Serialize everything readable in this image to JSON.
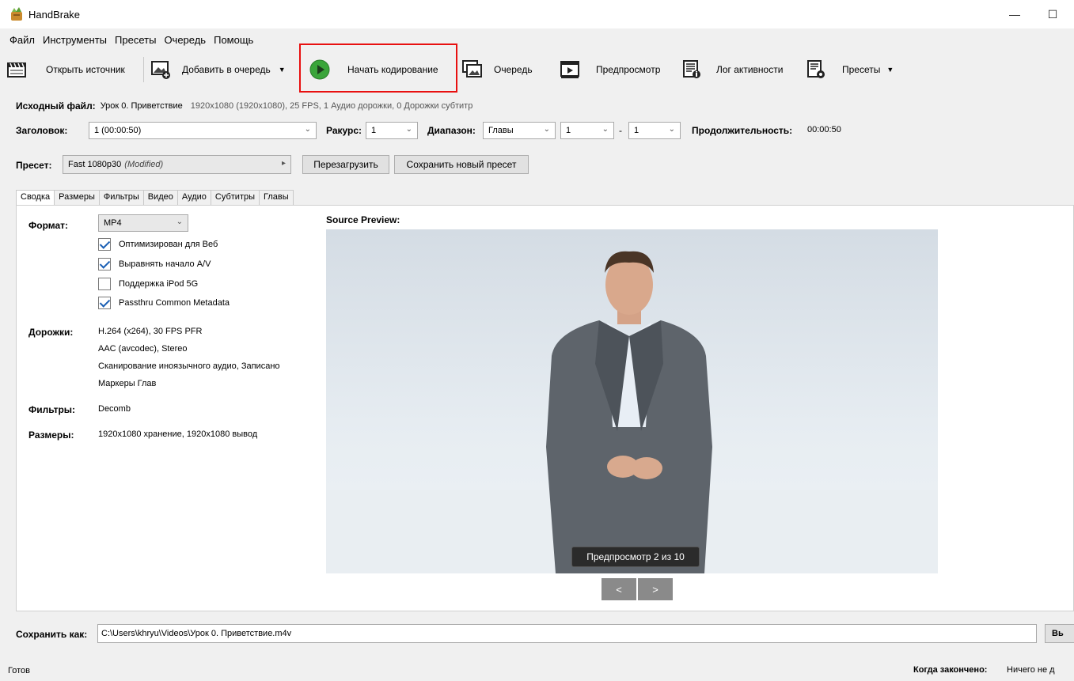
{
  "window": {
    "title": "HandBrake",
    "minimize": "—",
    "maximize": "☐"
  },
  "menu": [
    "Файл",
    "Инструменты",
    "Пресеты",
    "Очередь",
    "Помощь"
  ],
  "toolbar": {
    "open_source": "Открыть источник",
    "add_to_queue": "Добавить в очередь",
    "start_encode": "Начать кодирование",
    "queue": "Очередь",
    "preview": "Предпросмотр",
    "activity_log": "Лог активности",
    "presets": "Пресеты"
  },
  "source": {
    "label": "Исходный файл:",
    "name": "Урок 0. Приветствие",
    "info": "1920x1080 (1920x1080), 25 FPS, 1 Аудио дорожки, 0 Дорожки субтитр"
  },
  "title_row": {
    "title_label": "Заголовок:",
    "title_value": "1 (00:00:50)",
    "angle_label": "Ракурс:",
    "angle_value": "1",
    "range_label": "Диапазон:",
    "range_type": "Главы",
    "range_start": "1",
    "range_dash": "-",
    "range_end": "1",
    "duration_label": "Продолжительность:",
    "duration_value": "00:00:50"
  },
  "preset_row": {
    "label": "Пресет:",
    "value": "Fast 1080p30",
    "modified": "(Modified)",
    "reload": "Перезагрузить",
    "save_new": "Сохранить новый пресет"
  },
  "tabs": [
    "Сводка",
    "Размеры",
    "Фильтры",
    "Видео",
    "Аудио",
    "Субтитры",
    "Главы"
  ],
  "summary": {
    "format_label": "Формат:",
    "format_value": "MP4",
    "checkboxes": [
      {
        "label": "Оптимизирован для Веб",
        "checked": true
      },
      {
        "label": "Выравнять начало A/V",
        "checked": true
      },
      {
        "label": "Поддержка iPod 5G",
        "checked": false
      },
      {
        "label": "Passthru Common Metadata",
        "checked": true
      }
    ],
    "tracks_label": "Дорожки:",
    "tracks": [
      "H.264 (x264), 30 FPS PFR",
      "AAC (avcodec), Stereo",
      "Сканирование иноязычного аудио, Записано",
      "Маркеры Глав"
    ],
    "filters_label": "Фильтры:",
    "filters_value": "Decomb",
    "sizes_label": "Размеры:",
    "sizes_value": "1920x1080 хранение, 1920x1080 вывод"
  },
  "preview": {
    "heading": "Source Preview:",
    "overlay": "Предпросмотр 2 из 10",
    "prev": "<",
    "next": ">"
  },
  "save": {
    "label": "Сохранить как:",
    "path": "C:\\Users\\khryu\\Videos\\Урок 0. Приветствие.m4v",
    "browse": "Вь"
  },
  "status": {
    "left": "Готов",
    "when_done_label": "Когда закончено:",
    "when_done_value": "Ничего не д"
  },
  "colors": {
    "highlight": "#e81010",
    "play_green": "#3aa53a",
    "check_blue": "#1a5fb4"
  }
}
